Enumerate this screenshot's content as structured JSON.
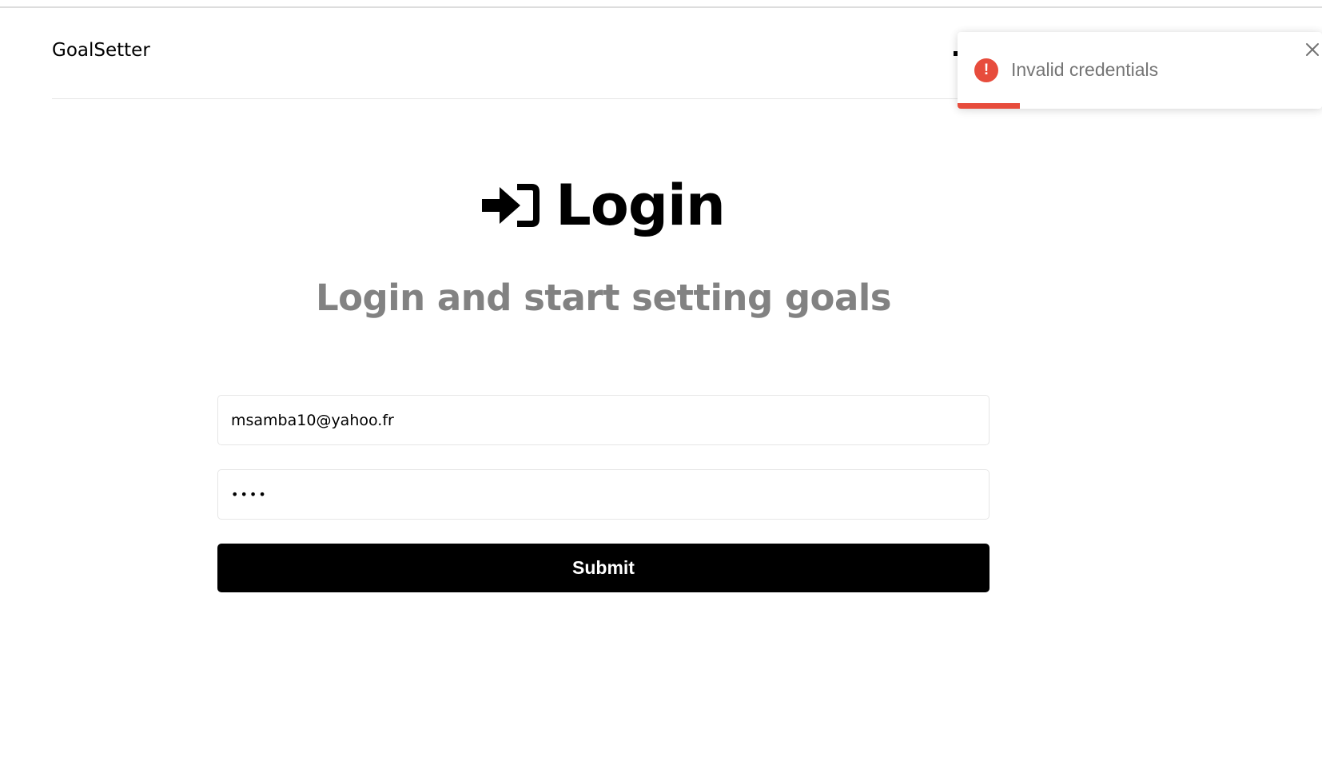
{
  "header": {
    "brand": "GoalSetter"
  },
  "main": {
    "heading_icon": "sign-in-icon",
    "heading": "Login",
    "subheading": "Login and start setting goals"
  },
  "form": {
    "email_value": "msamba10@yahoo.fr",
    "password_masked": "••••",
    "submit_label": "Submit"
  },
  "toast": {
    "type": "error",
    "icon": "exclamation-circle-icon",
    "message": "Invalid credentials",
    "close_icon": "close-icon",
    "progress_percent": 17,
    "accent_color": "#e74c3c"
  }
}
